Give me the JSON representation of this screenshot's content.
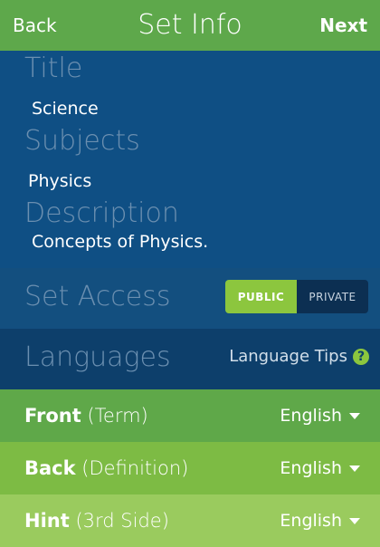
{
  "header": {
    "back_label": "Back",
    "title": "Set Info",
    "next_label": "Next"
  },
  "form": {
    "title_label": "Title",
    "title_value": "Science",
    "subjects_label": "Subjects",
    "subjects_value": "Physics",
    "description_label": "Description",
    "description_value": "Concepts of Physics."
  },
  "access": {
    "label": "Set Access",
    "public_label": "PUBLIC",
    "private_label": "PRIVATE",
    "selected": "PUBLIC"
  },
  "languages": {
    "label": "Languages",
    "tips_label": "Language Tips",
    "tips_icon": "?"
  },
  "sides": [
    {
      "name": "Front",
      "sub": "(Term)",
      "language": "English"
    },
    {
      "name": "Back",
      "sub": "(Definition)",
      "language": "English"
    },
    {
      "name": "Hint",
      "sub": "(3rd Side)",
      "language": "English"
    }
  ],
  "colors": {
    "green": "#5ea84b",
    "accent": "#8cc63e",
    "blue": "#0f4f84"
  }
}
